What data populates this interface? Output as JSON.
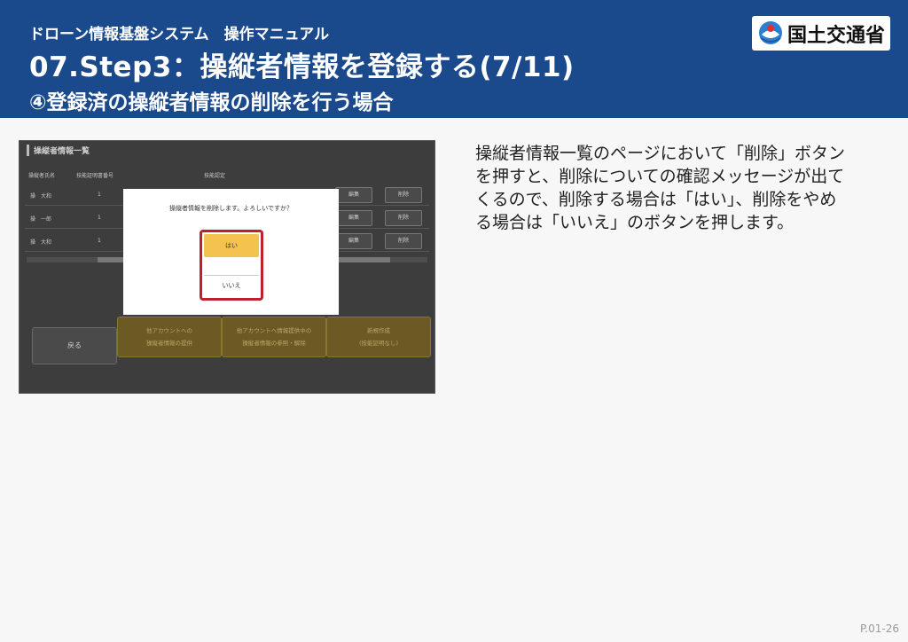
{
  "header": {
    "system": "ドローン情報基盤システム　操作マニュアル",
    "title": "07.Step3：操縦者情報を登録する(7/11)",
    "subtitle": "④登録済の操縦者情報の削除を行う場合",
    "logo_text": "国土交通省"
  },
  "screenshot": {
    "heading": "操縦者情報一覧",
    "columns": [
      "操縦者氏名",
      "技能証明書番号",
      "技能認定"
    ],
    "rows": [
      {
        "name": "操　大和",
        "num": "1",
        "edit": "編集",
        "delete": "削除"
      },
      {
        "name": "操　一郎",
        "num": "1",
        "edit": "編集",
        "delete": "削除"
      },
      {
        "name": "操　大和",
        "num": "1",
        "edit": "編集",
        "delete": "削除"
      }
    ],
    "dialog": {
      "message": "操縦者情報を削除します。よろしいですか？",
      "yes": "はい",
      "no": "いいえ"
    },
    "buttons": {
      "back": "戻る",
      "provide_l1": "他アカウントへの",
      "provide_l2": "操縦者情報の提供",
      "ref_l1": "他アカウントへ情報提供中の",
      "ref_l2": "操縦者情報の参照・解除",
      "new_l1": "新規作成",
      "new_l2": "(技能証明なし)"
    }
  },
  "description": [
    "操縦者情報一覧のページにおいて「削除」ボタン",
    "を押すと、削除についての確認メッセージが出て",
    "くるので、削除する場合は「はい」、削除をやめ",
    "る場合は「いいえ」のボタンを押します。"
  ],
  "page_number": "P.01-26",
  "colors": {
    "header_bg": "#1b4a8c",
    "highlight": "#c0202a",
    "yes_button": "#f3c24f"
  }
}
